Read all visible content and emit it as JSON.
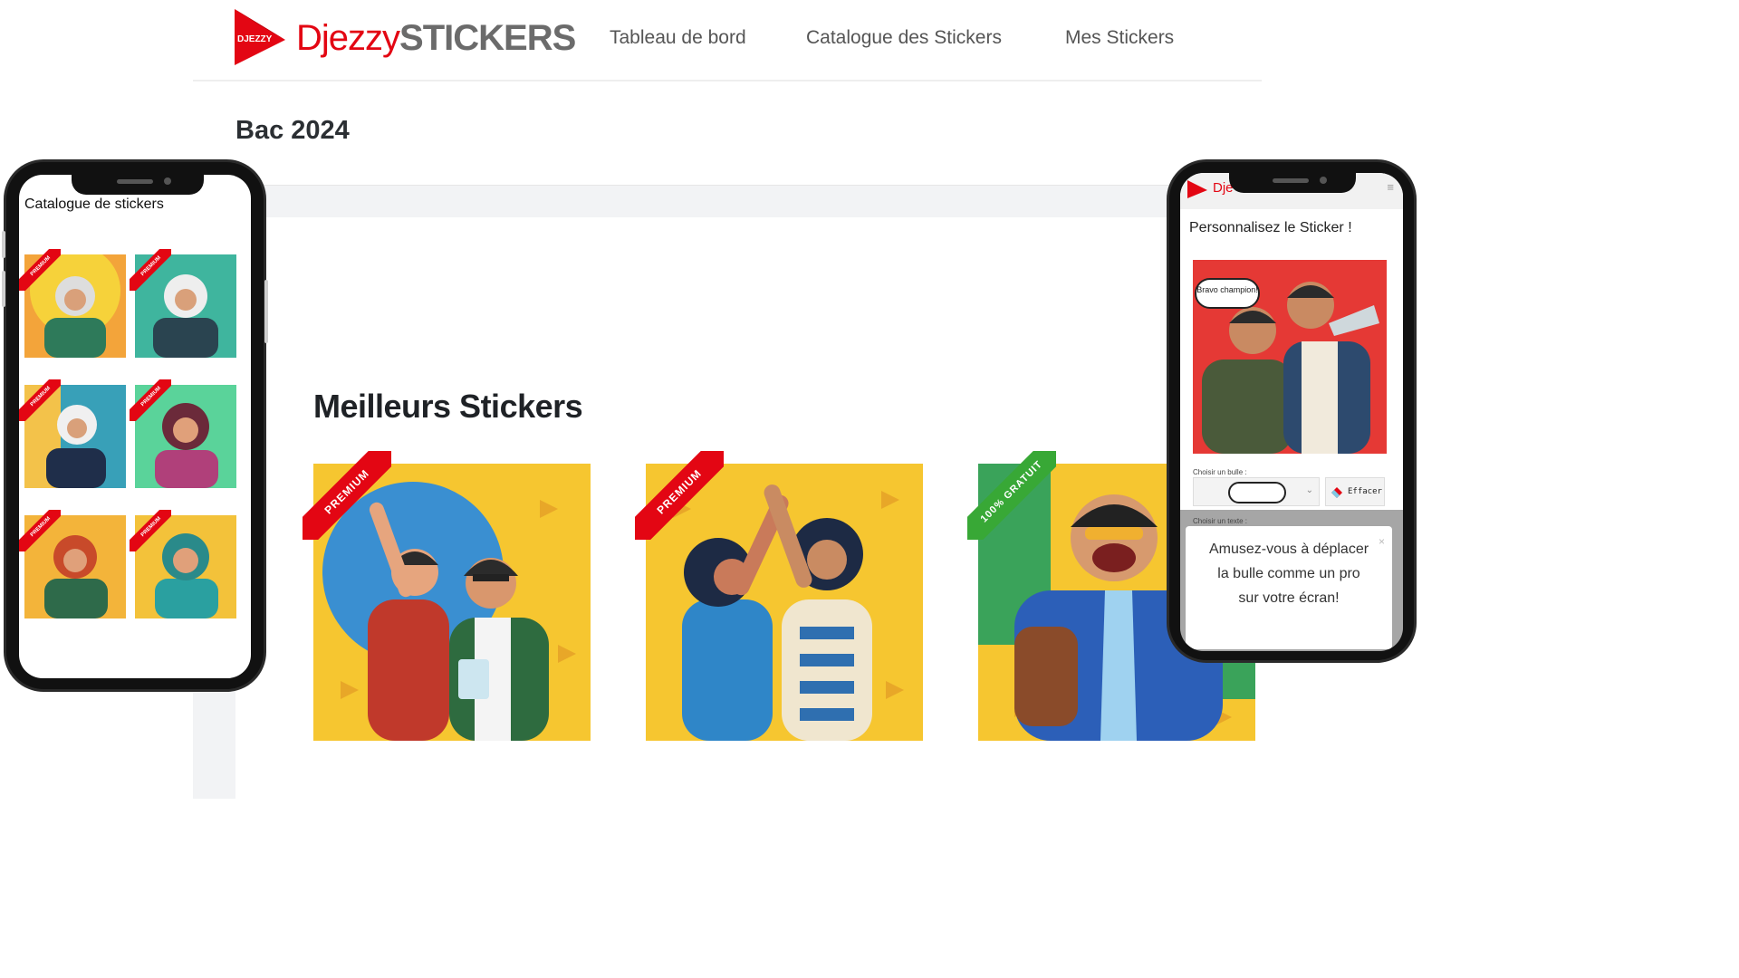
{
  "brand": {
    "mark_text": "DJEZZY",
    "name_part1": "Djezzy",
    "name_part2": "STICKERS",
    "accent": "#e30613"
  },
  "nav": {
    "items": [
      "Tableau de bord",
      "Catalogue des Stickers",
      "Mes Stickers"
    ]
  },
  "page": {
    "title": "Bac 2024",
    "section_title": "Meilleurs Stickers"
  },
  "stickers": [
    {
      "badge": "PREMIUM",
      "badge_color": "#e30613"
    },
    {
      "badge": "PREMIUM",
      "badge_color": "#e30613"
    },
    {
      "badge": "100% GRATUIT",
      "badge_color": "#38a836"
    }
  ],
  "phone_left": {
    "title": "Catalogue de stickers",
    "items": [
      {
        "badge": "PREMIUM"
      },
      {
        "badge": "PREMIUM"
      },
      {
        "badge": "PREMIUM"
      },
      {
        "badge": "PREMIUM"
      },
      {
        "badge": "PREMIUM"
      },
      {
        "badge": "PREMIUM"
      }
    ]
  },
  "phone_right": {
    "header_brand": "Dje",
    "title": "Personnalisez le Sticker !",
    "bubble_text": "Bravo champion!",
    "label_bubble": "Choisir un bulle :",
    "label_text": "Choisir un texte :",
    "erase_label": "Effacer",
    "toast_text": "Amusez-vous à déplacer la bulle comme un pro sur votre écran!",
    "toast_close": "×"
  }
}
